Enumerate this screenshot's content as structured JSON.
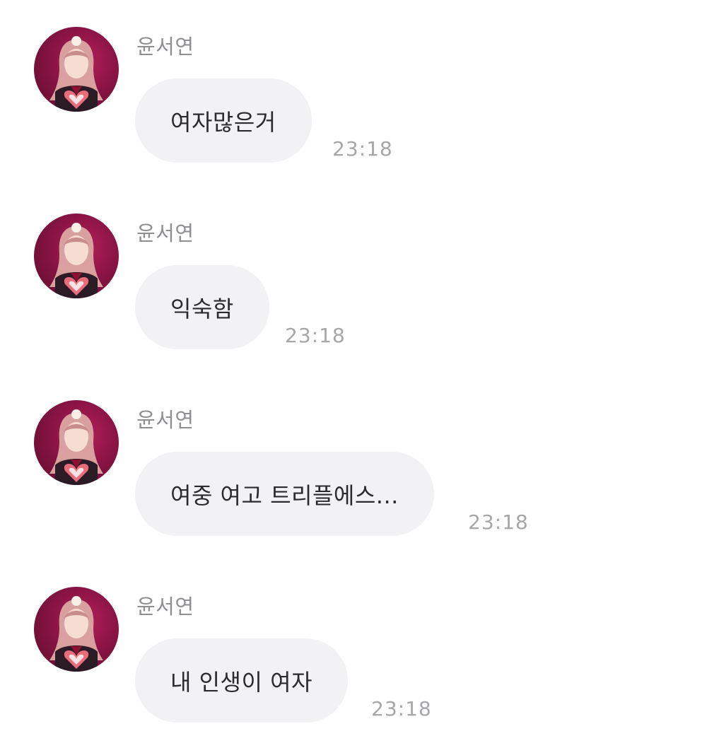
{
  "messages": [
    {
      "sender": "윤서연",
      "text": "여자많은거",
      "time": "23:18"
    },
    {
      "sender": "윤서연",
      "text": "익숙함",
      "time": "23:18"
    },
    {
      "sender": "윤서연",
      "text": "여중 여고 트리플에스...",
      "time": "23:18"
    },
    {
      "sender": "윤서연",
      "text": "내 인생이 여자",
      "time": "23:18"
    }
  ],
  "icons": {
    "avatar": "profile-photo-avatar"
  },
  "colors": {
    "bubble": "#f2f2f5",
    "sender": "#8e8e93",
    "time": "#a6a6ab",
    "text": "#2b2b2e",
    "avatar_bg": "#8a1444"
  }
}
